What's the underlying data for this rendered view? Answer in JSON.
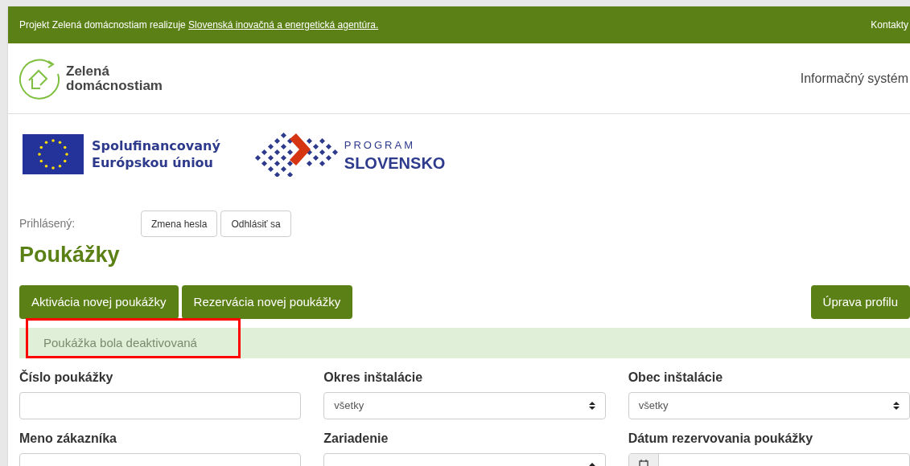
{
  "top_bar": {
    "text": "Projekt Zelená domácnostiam realizuje",
    "link": "Slovenská inovačná a energetická agentúra.",
    "contacts": "Kontakty"
  },
  "header": {
    "logo_line1": "Zelená",
    "logo_line2": "domácnostiam",
    "system": "Informačný systém"
  },
  "partners": {
    "eu_line1": "Spolufinancovaný",
    "eu_line2": "Európskou úniou",
    "program_top": "PROGRAM",
    "program_bottom": "SLOVENSKO"
  },
  "user": {
    "label": "Prihlásený:",
    "buttons": [
      "Zmena hesla",
      "Odhlásiť sa"
    ]
  },
  "title": "Poukážky",
  "actions": {
    "left": [
      "Aktivácia novej poukážky",
      "Rezervácia novej poukážky"
    ],
    "right": "Úprava profilu"
  },
  "alert": {
    "text": "Poukážka bola deaktivovaná",
    "highlighted": true
  },
  "filters": [
    {
      "label": "Číslo poukážky",
      "kind": "text"
    },
    {
      "label": "Okres inštalácie",
      "kind": "select",
      "value": "všetky"
    },
    {
      "label": "Obec inštalácie",
      "kind": "select",
      "value": "všetky"
    },
    {
      "label": "Meno zákazníka",
      "kind": "text"
    },
    {
      "label": "Zariadenie",
      "kind": "select"
    },
    {
      "label": "Dátum rezervovania poukážky",
      "kind": "date"
    }
  ]
}
